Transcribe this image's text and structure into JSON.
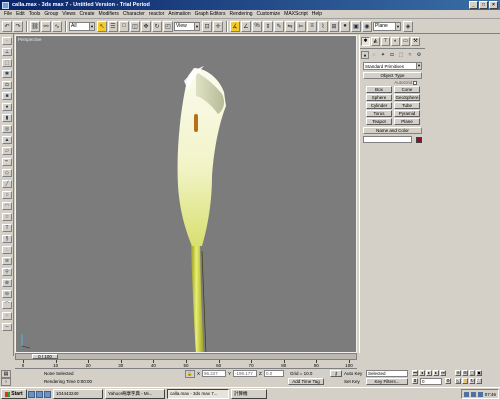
{
  "window": {
    "title": "calla.max - 3ds max 7 - Untitled Version - Trial Period",
    "buttons": [
      "_",
      "□",
      "×"
    ]
  },
  "menubar": [
    "File",
    "Edit",
    "Tools",
    "Group",
    "Views",
    "Create",
    "Modifiers",
    "Character",
    "reactor",
    "Animation",
    "Graph Editors",
    "Rendering",
    "Customize",
    "MAXScript",
    "Help"
  ],
  "toolbar": {
    "filter_value": "All",
    "refcoord_value": "View",
    "named_sel_value": "Plane"
  },
  "viewport": {
    "label": "Perspective",
    "background": "#7c7c7c"
  },
  "command_panel": {
    "category": "Standard Primitives",
    "object_type_header": "Object Type",
    "autogrid_label": "AutoGrid",
    "objects": [
      "Box",
      "Cone",
      "Sphere",
      "GeoSphere",
      "Cylinder",
      "Tube",
      "Torus",
      "Pyramid",
      "Teapot",
      "Plane"
    ],
    "name_color_header": "Name and Color",
    "name_value": "",
    "swatch_color": "#8a1030"
  },
  "timeline": {
    "frame_label": "0 / 100",
    "ticks": [
      "0",
      "10",
      "20",
      "30",
      "40",
      "50",
      "60",
      "70",
      "80",
      "90",
      "100"
    ]
  },
  "statusbar": {
    "selection": "None Selected",
    "rendering_time": "Rendering Time  0:00:00",
    "x_value": "96.227",
    "y_value": "-199.177",
    "z_value": "0.0",
    "grid": "Grid = 10.0",
    "add_time_tag": "Add Time Tag",
    "auto_key": "Auto Key",
    "set_key": "Set Key",
    "key_mode_value": "Selected",
    "key_filters": "Key Filters...",
    "frame_value": "0"
  },
  "taskbar": {
    "start": "Start",
    "tasks": [
      "104443240",
      "Yahoo!奇摩字典 - Mi...",
      "calla.max - 3ds max 7...",
      "計算機"
    ],
    "clock": "07:46"
  },
  "colors": {
    "titlebar_start": "#0a246a",
    "titlebar_end": "#3a6ea5",
    "chrome": "#d4d0c8",
    "highlight_button": "#f2cc2a"
  }
}
